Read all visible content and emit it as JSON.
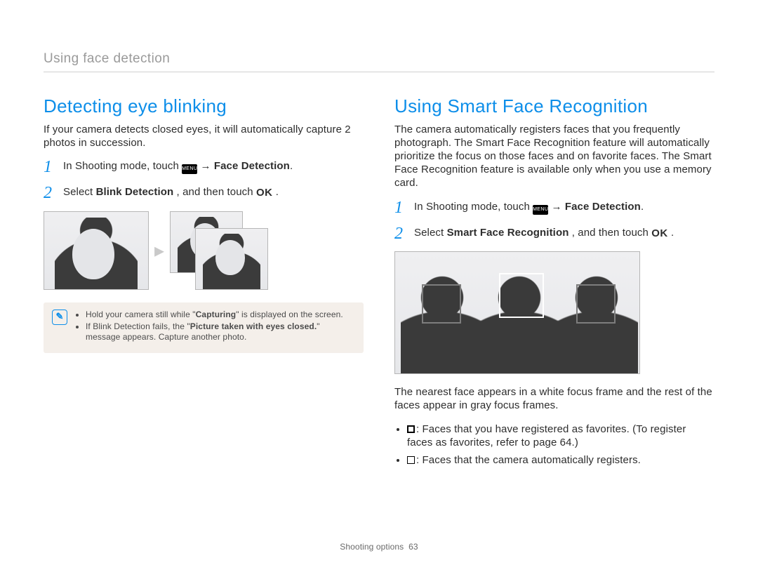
{
  "runningHead": "Using face detection",
  "footer": {
    "section": "Shooting options",
    "page": "63"
  },
  "left": {
    "heading": "Detecting eye blinking",
    "intro": "If your camera detects closed eyes, it will automatically capture 2 photos in succession.",
    "step1_prefix": "In Shooting mode, touch ",
    "step1_arrow": " → ",
    "step1_bold": "Face Detection",
    "step1_suffix": ".",
    "step2_prefix": "Select ",
    "step2_bold": "Blink Detection",
    "step2_mid": ", and then touch ",
    "step2_suffix": ".",
    "note1_a": "Hold your camera still while \"",
    "note1_bold": "Capturing",
    "note1_b": "\" is displayed on the screen.",
    "note2_a": "If Blink Detection fails, the \"",
    "note2_bold": "Picture taken with eyes closed.",
    "note2_b": "\" message appears. Capture another photo.",
    "menuLabel": "MENU",
    "okLabel": "OK"
  },
  "right": {
    "heading": "Using Smart Face Recognition",
    "intro": "The camera automatically registers faces that you frequently photograph. The Smart Face Recognition feature will automatically prioritize the focus on those faces and on favorite faces. The Smart Face Recognition feature is available only when you use a memory card.",
    "step1_prefix": "In Shooting mode, touch ",
    "step1_arrow": " → ",
    "step1_bold": "Face Detection",
    "step1_suffix": ".",
    "step2_prefix": "Select ",
    "step2_bold": "Smart Face Recognition",
    "step2_mid": ", and then touch ",
    "step2_suffix": ".",
    "menuLabel": "MENU",
    "okLabel": "OK",
    "afterIllus": "The nearest face appears in a white focus frame and the rest of the faces appear in gray focus frames.",
    "legend1": ": Faces that you have registered as favorites. (To register faces as favorites, refer to page 64.)",
    "legend2": ": Faces that the camera automatically registers."
  }
}
